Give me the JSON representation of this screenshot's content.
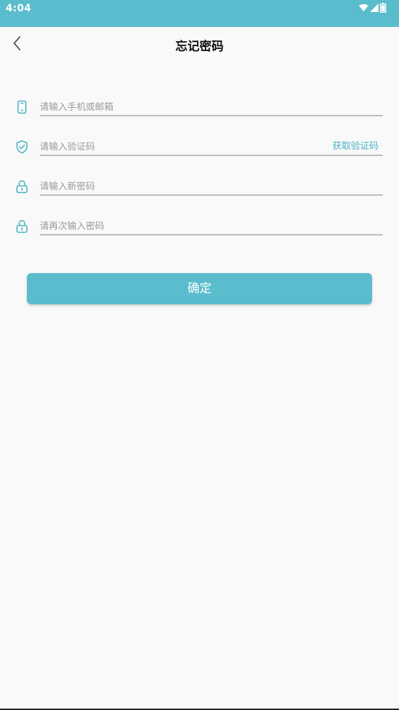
{
  "status_bar": {
    "time": "4:04",
    "icons": [
      "wifi-icon",
      "signal-icon",
      "battery-icon"
    ]
  },
  "header": {
    "back_icon": "chevron-left-icon",
    "title": "忘记密码"
  },
  "form": {
    "phone_or_email": {
      "icon": "phone-icon",
      "placeholder": "请输入手机或邮箱",
      "value": ""
    },
    "verification_code": {
      "icon": "shield-check-icon",
      "placeholder": "请输入验证码",
      "value": "",
      "action_label": "获取验证码"
    },
    "new_password": {
      "icon": "lock-icon",
      "placeholder": "请输入新密码",
      "value": ""
    },
    "confirm_password": {
      "icon": "lock-icon",
      "placeholder": "请再次输入密码",
      "value": ""
    },
    "submit_label": "确定"
  },
  "colors": {
    "accent": "#5bbccd",
    "link": "#4bb3c6",
    "background": "#f9f9f9"
  }
}
